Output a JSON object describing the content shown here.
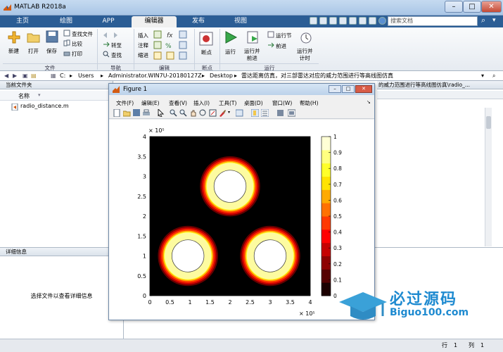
{
  "window": {
    "title": "MATLAB R2018a",
    "min": "–",
    "max": "□",
    "close": "✕"
  },
  "tabs": [
    "主页",
    "绘图",
    "APP",
    "编辑器",
    "发布",
    "视图"
  ],
  "search": {
    "placeholder": "搜索文档"
  },
  "ribbon": {
    "new": "新建",
    "open": "打开",
    "save": "保存",
    "find_files": "查找文件",
    "compare": "比较",
    "print": "打印",
    "goto": "转至",
    "find": "查找",
    "insert": "插入",
    "comment": "注释",
    "indent": "缩进",
    "breakpoints": "断点",
    "run": "运行",
    "run_advance": "运行并\n前进",
    "run_section": "运行节",
    "advance": "前进",
    "run_time": "运行并\n计时",
    "groups": [
      "文件",
      "导航",
      "编辑",
      "断点",
      "运行"
    ]
  },
  "address": {
    "parts": [
      "C:",
      "Users",
      "Administrator.WIN7U-20180127Z",
      "Desktop",
      "雷达距离仿真，对三部雷达对应的威力范围进行等高线图仿真"
    ]
  },
  "current_folder": {
    "title": "当前文件夹",
    "col": "名称",
    "files": [
      "radio_distance.m"
    ]
  },
  "details": {
    "title": "详细信息",
    "hint": "选择文件以查看详细信息"
  },
  "editor": {
    "path": "的威力范围进行等高线图仿真\\radio_..."
  },
  "status": {
    "row_label": "行",
    "row": "1",
    "col_label": "列",
    "col": "1"
  },
  "figure": {
    "title": "Figure 1",
    "menus": [
      "文件(F)",
      "编辑(E)",
      "查看(V)",
      "插入(I)",
      "工具(T)",
      "桌面(D)",
      "窗口(W)",
      "帮助(H)"
    ],
    "xexp": "× 10⁵",
    "yexp": "× 10⁵"
  },
  "chart_data": {
    "type": "heatmap",
    "title": "",
    "xlabel": "",
    "ylabel": "",
    "xlim": [
      0,
      400000
    ],
    "ylim": [
      0,
      400000
    ],
    "x_ticks": [
      "0",
      "0.5",
      "1",
      "1.5",
      "2",
      "2.5",
      "3",
      "3.5",
      "4"
    ],
    "y_ticks": [
      "0",
      "0.5",
      "1",
      "1.5",
      "2",
      "2.5",
      "3",
      "3.5",
      "4"
    ],
    "colorbar_ticks": [
      "0",
      "0.1",
      "0.2",
      "0.3",
      "0.4",
      "0.5",
      "0.6",
      "0.7",
      "0.8",
      "0.9",
      "1"
    ],
    "colormap": "hot",
    "radars": [
      {
        "x": 95000,
        "y": 100000
      },
      {
        "x": 200000,
        "y": 275000
      },
      {
        "x": 300000,
        "y": 100000
      }
    ],
    "inner_radius": 40000,
    "plateau_radius": 58000,
    "outer_radius": 75000
  },
  "watermark": {
    "brand": "必过源码",
    "url": "Biguo100.com"
  }
}
